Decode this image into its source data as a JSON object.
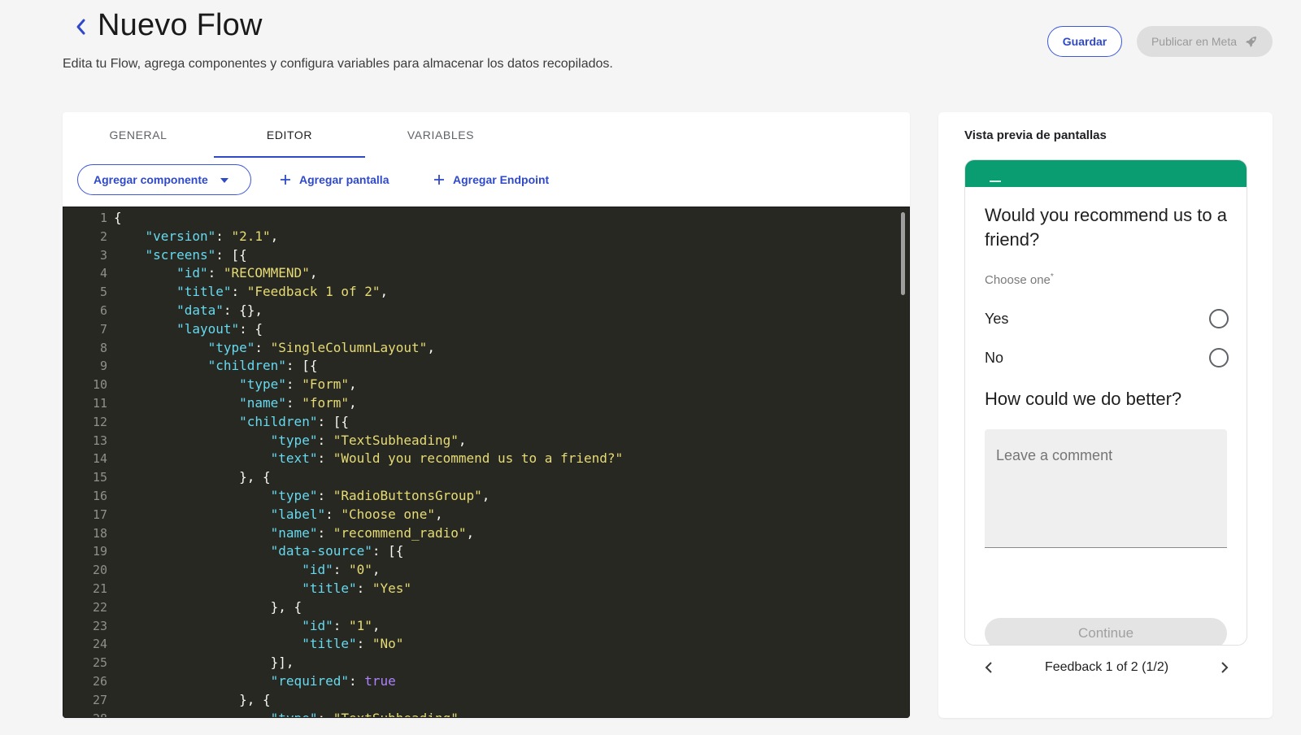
{
  "header": {
    "title": "Nuevo Flow",
    "subtitle": "Edita tu Flow, agrega componentes y configura variables para almacenar los datos recopilados.",
    "save_label": "Guardar",
    "publish_label": "Publicar en Meta",
    "back_icon": "chevron-left-icon",
    "publish_icon": "rocket-icon"
  },
  "tabs": [
    {
      "label": "GENERAL",
      "active": false
    },
    {
      "label": "EDITOR",
      "active": true
    },
    {
      "label": "VARIABLES",
      "active": false
    }
  ],
  "toolbar": {
    "add_component_label": "Agregar componente",
    "add_screen_label": "Agregar pantalla",
    "add_endpoint_label": "Agregar Endpoint"
  },
  "editor": {
    "lines": [
      "{",
      "    \"version\": \"2.1\",",
      "    \"screens\": [{",
      "        \"id\": \"RECOMMEND\",",
      "        \"title\": \"Feedback 1 of 2\",",
      "        \"data\": {},",
      "        \"layout\": {",
      "            \"type\": \"SingleColumnLayout\",",
      "            \"children\": [{",
      "                \"type\": \"Form\",",
      "                \"name\": \"form\",",
      "                \"children\": [{",
      "                    \"type\": \"TextSubheading\",",
      "                    \"text\": \"Would you recommend us to a friend?\"",
      "                }, {",
      "                    \"type\": \"RadioButtonsGroup\",",
      "                    \"label\": \"Choose one\",",
      "                    \"name\": \"recommend_radio\",",
      "                    \"data-source\": [{",
      "                        \"id\": \"0\",",
      "                        \"title\": \"Yes\"",
      "                    }, {",
      "                        \"id\": \"1\",",
      "                        \"title\": \"No\"",
      "                    }],",
      "                    \"required\": true",
      "                }, {",
      "                    \"type\": \"TextSubheading\","
    ]
  },
  "preview": {
    "title": "Vista previa de pantallas",
    "question1": "Would you recommend us to a friend?",
    "radio_label": "Choose one",
    "required_mark": "*",
    "options": [
      "Yes",
      "No"
    ],
    "question2": "How could we do better?",
    "comment_placeholder": "Leave a comment",
    "continue_label": "Continue",
    "pager_text": "Feedback 1 of 2 (1/2)",
    "header_color": "#0a9d72"
  }
}
